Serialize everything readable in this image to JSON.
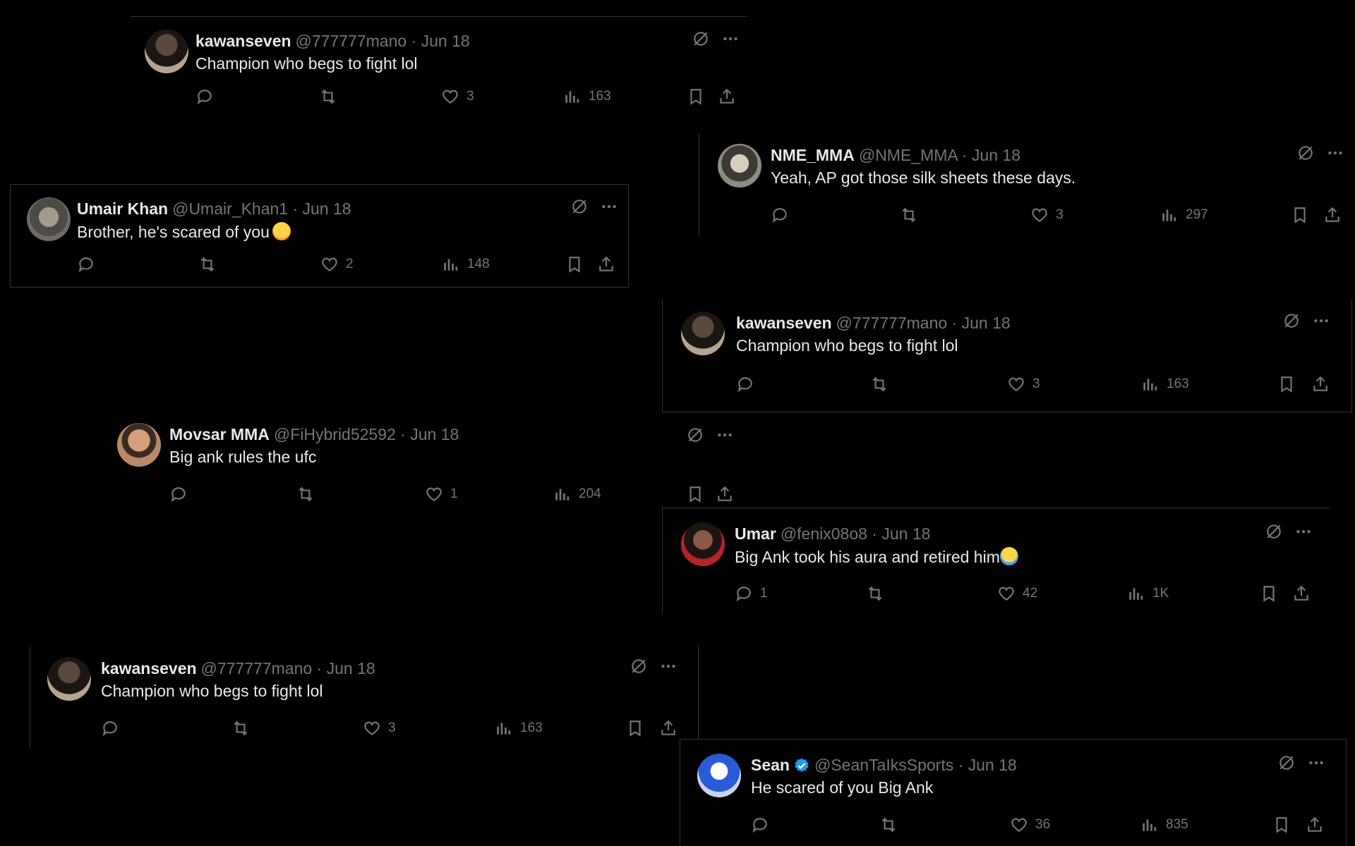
{
  "posts": [
    {
      "name": "kawanseven",
      "handle": "@777777mano · Jun 18",
      "text": "Champion who begs to fight lol",
      "replies": "",
      "likes": "3",
      "views": "163"
    },
    {
      "name": "NME_MMA",
      "handle": "@NME_MMA · Jun 18",
      "text": "Yeah, AP got those silk sheets these days.",
      "replies": "",
      "likes": "3",
      "views": "297"
    },
    {
      "name": "Umair Khan",
      "handle": "@Umair_Khan1 · Jun 18",
      "text": "Brother, he's scared of you",
      "replies": "",
      "likes": "2",
      "views": "148"
    },
    {
      "name": "kawanseven",
      "handle": "@777777mano · Jun 18",
      "text": "Champion who begs to fight lol",
      "replies": "",
      "likes": "3",
      "views": "163"
    },
    {
      "name": "Movsar MMA",
      "handle": "@FiHybrid52592 · Jun 18",
      "text": "Big ank rules the ufc",
      "replies": "",
      "likes": "1",
      "views": "204"
    },
    {
      "name": "Umar",
      "handle": "@fenix08o8 · Jun 18",
      "text": "Big Ank took his aura and retired him",
      "replies": "1",
      "likes": "42",
      "views": "1K"
    },
    {
      "name": "kawanseven",
      "handle": "@777777mano · Jun 18",
      "text": "Champion who begs to fight lol",
      "replies": "",
      "likes": "3",
      "views": "163"
    },
    {
      "name": "Sean",
      "handle": "@SeanTaIksSports · Jun 18",
      "text": "He scared of you Big Ank",
      "replies": "",
      "likes": "36",
      "views": "835"
    }
  ],
  "icons": {
    "reply": "reply-icon",
    "repost": "repost-icon",
    "like": "heart-icon",
    "views": "views-icon",
    "bookmark": "bookmark-icon",
    "share": "share-icon",
    "grok": "grok-icon",
    "more": "more-icon"
  },
  "colors": {
    "background": "#000000",
    "text": "#e7e9ea",
    "muted": "#71767b",
    "border": "#2f3336",
    "verified": "#1d9bf0"
  }
}
